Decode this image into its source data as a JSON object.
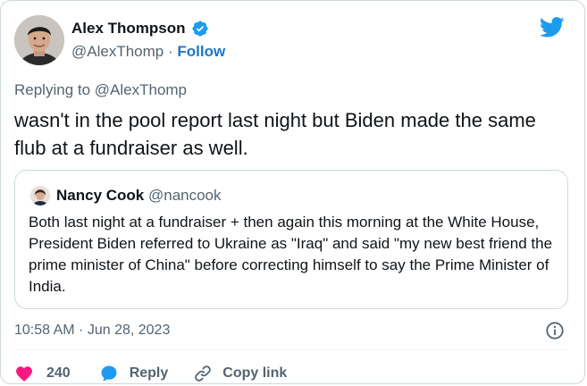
{
  "author": {
    "name": "Alex Thompson",
    "handle": "@AlexThomp",
    "separator": "·",
    "follow_label": "Follow"
  },
  "reply_context": "Replying to @AlexThomp",
  "tweet_text": "wasn't in the pool report last night but Biden made the same flub at a fundraiser as well.",
  "quote": {
    "name": "Nancy Cook",
    "handle": "@nancook",
    "text": "Both last night at a fundraiser + then again this morning at the White House, President Biden referred to Ukraine as \"Iraq\" and said \"my new best friend the prime minister of China\" before correcting himself to say the Prime Minister of India."
  },
  "timestamp": "10:58 AM · Jun 28, 2023",
  "actions": {
    "like_count": "240",
    "reply_label": "Reply",
    "copy_link_label": "Copy link"
  },
  "icons": {
    "verified": "verified-badge-icon",
    "brand": "twitter-bird-icon",
    "info": "info-icon",
    "like": "heart-icon",
    "reply": "speech-bubble-icon",
    "copy": "link-icon"
  },
  "colors": {
    "brand_blue": "#1d9bf0",
    "follow_blue": "#1d76c3",
    "like_pink": "#f91880",
    "muted_text": "#536471",
    "border": "#cfd9de"
  }
}
